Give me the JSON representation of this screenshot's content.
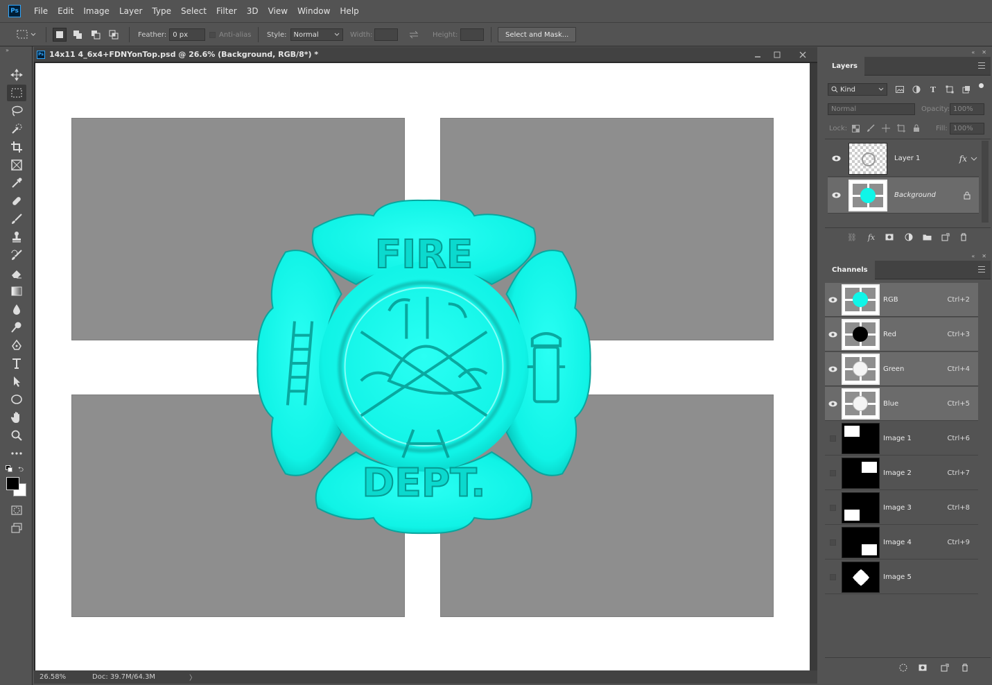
{
  "app": {
    "logo_text": "Ps"
  },
  "menu": [
    "File",
    "Edit",
    "Image",
    "Layer",
    "Type",
    "Select",
    "Filter",
    "3D",
    "View",
    "Window",
    "Help"
  ],
  "options": {
    "feather_label": "Feather:",
    "feather_value": "0 px",
    "antialias_label": "Anti-alias",
    "style_label": "Style:",
    "style_value": "Normal",
    "width_label": "Width:",
    "height_label": "Height:",
    "select_mask_label": "Select and Mask..."
  },
  "document": {
    "tab_icon_text": "Ps",
    "title": "14x11 4_6x4+FDNYonTop.psd @ 26.6% (Background, RGB/8*) *",
    "zoom": "26.58%",
    "doc_size": "Doc: 39.7M/64.3M",
    "badge_top_text": "FIRE",
    "badge_bottom_text": "DEPT."
  },
  "layers_panel": {
    "tab_label": "Layers",
    "filter_kind": "Kind",
    "blend_mode": "Normal",
    "opacity_label": "Opacity:",
    "opacity_value": "100%",
    "lock_label": "Lock:",
    "fill_label": "Fill:",
    "fill_value": "100%",
    "layers": [
      {
        "name": "Layer 1",
        "fx": "fx"
      },
      {
        "name": "Background"
      }
    ]
  },
  "channels_panel": {
    "tab_label": "Channels",
    "channels": [
      {
        "name": "RGB",
        "shortcut": "Ctrl+2"
      },
      {
        "name": "Red",
        "shortcut": "Ctrl+3"
      },
      {
        "name": "Green",
        "shortcut": "Ctrl+4"
      },
      {
        "name": "Blue",
        "shortcut": "Ctrl+5"
      },
      {
        "name": "Image 1",
        "shortcut": "Ctrl+6"
      },
      {
        "name": "Image 2",
        "shortcut": "Ctrl+7"
      },
      {
        "name": "Image 3",
        "shortcut": "Ctrl+8"
      },
      {
        "name": "Image 4",
        "shortcut": "Ctrl+9"
      },
      {
        "name": "Image 5",
        "shortcut": ""
      }
    ]
  },
  "colors": {
    "badge": "#10f5e8",
    "ui_dark": "#535353",
    "accent": "#31a8ff"
  }
}
